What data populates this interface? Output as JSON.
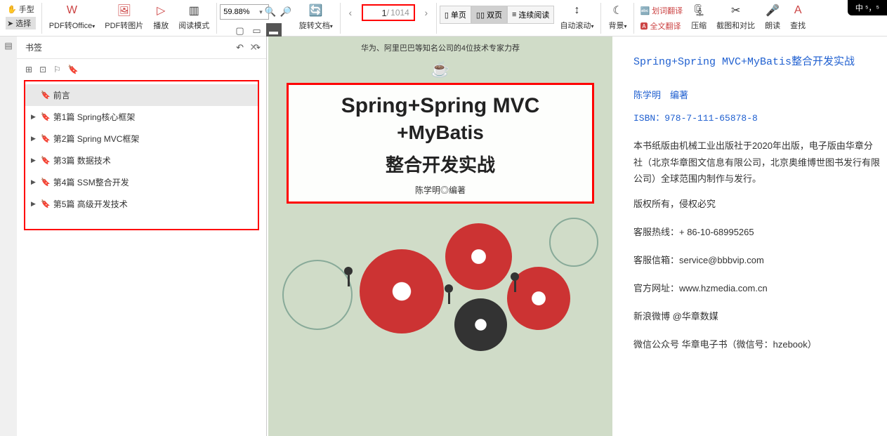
{
  "toolbar": {
    "hand": "手型",
    "select": "选择",
    "pdf_office": "PDF转Office",
    "pdf_image": "PDF转图片",
    "play": "播放",
    "read_mode": "阅读模式",
    "zoom_value": "59.88%",
    "rotate": "旋转文档",
    "page_current": "1",
    "page_total": "1014",
    "single": "单页",
    "double": "双页",
    "continuous": "连续阅读",
    "auto_scroll": "自动滚动",
    "background": "背景",
    "word_trans": "划词翻译",
    "full_trans": "全文翻译",
    "compress": "压缩",
    "crop_compare": "截图和对比",
    "read_aloud": "朗读",
    "find": "查找"
  },
  "sidebar": {
    "title": "书签",
    "items": [
      {
        "label": "前言",
        "has_children": false
      },
      {
        "label": "第1篇 Spring核心框架",
        "has_children": true
      },
      {
        "label": "第2篇 Spring MVC框架",
        "has_children": true
      },
      {
        "label": "第3篇 数据技术",
        "has_children": true
      },
      {
        "label": "第4篇 SSM整合开发",
        "has_children": true
      },
      {
        "label": "第5篇 高级开发技术",
        "has_children": true
      }
    ]
  },
  "cover": {
    "banner": "华为、阿里巴巴等知名公司的4位技术专家力荐",
    "title_line1": "Spring+Spring MVC",
    "title_line2": "+MyBatis",
    "title_line3": "整合开发实战",
    "author_line": "陈学明◎编著"
  },
  "info": {
    "title": "Spring+Spring MVC+MyBatis整合开发实战",
    "author": "陈学明　编著",
    "isbn": "ISBN：978-7-111-65878-8",
    "desc": "本书纸版由机械工业出版社于2020年出版，电子版由华章分社（北京华章图文信息有限公司，北京奥维博世图书发行有限公司）全球范围内制作与发行。",
    "copyright": "版权所有，侵权必究",
    "hotline": "客服热线：+ 86-10-68995265",
    "email": "客服信箱：service@bbbvip.com",
    "website": "官方网址：www.hzmedia.com.cn",
    "weibo": "新浪微博 @华章数媒",
    "wechat": "微信公众号 华章电子书（微信号：hzebook）"
  },
  "badge": "中 ⁵，⁵"
}
